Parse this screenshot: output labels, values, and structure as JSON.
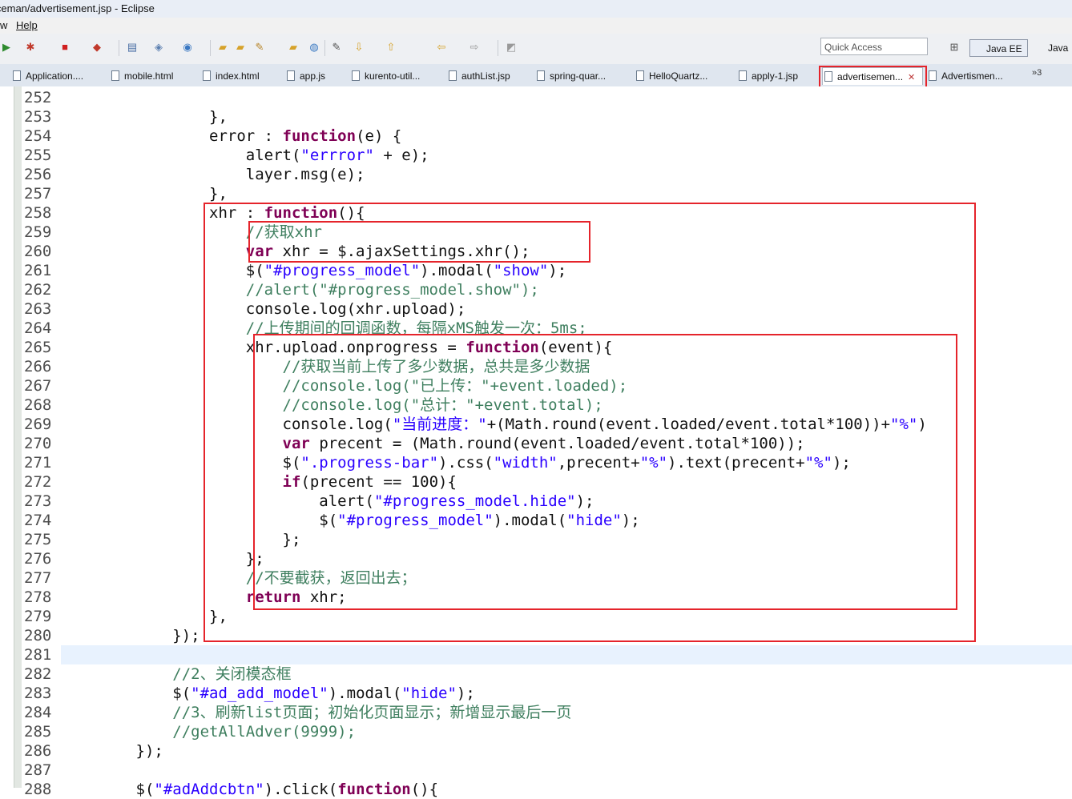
{
  "window": {
    "title": "iceman/advertisement.jsp - Eclipse"
  },
  "menu": {
    "items": [
      "w",
      "Help"
    ]
  },
  "toolbar": {
    "quick_access_placeholder": "Quick Access",
    "perspectives": [
      "Java EE",
      "Java"
    ]
  },
  "tabs": [
    {
      "label": "Application....",
      "active": false
    },
    {
      "label": "mobile.html",
      "active": false
    },
    {
      "label": "index.html",
      "active": false
    },
    {
      "label": "app.js",
      "active": false
    },
    {
      "label": "kurento-util...",
      "active": false
    },
    {
      "label": "authList.jsp",
      "active": false
    },
    {
      "label": "spring-quar...",
      "active": false
    },
    {
      "label": "HelloQuartz...",
      "active": false
    },
    {
      "label": "apply-1.jsp",
      "active": false
    },
    {
      "label": "advertisemen...",
      "active": true
    },
    {
      "label": "Advertismen...",
      "active": false
    }
  ],
  "tabs_overflow": "»3",
  "editor": {
    "highlight_color": "#e8f2fe",
    "annotation_color": "#e5242b",
    "lines": [
      {
        "n": "252",
        "code": []
      },
      {
        "n": "253",
        "code": [
          [
            "",
            "                },"
          ]
        ]
      },
      {
        "n": "254",
        "code": [
          [
            "",
            "                error : "
          ],
          [
            "kw",
            "function"
          ],
          [
            "",
            "(e) {"
          ]
        ]
      },
      {
        "n": "255",
        "code": [
          [
            "",
            "                    alert("
          ],
          [
            "str",
            "\"errror\""
          ],
          [
            "",
            " + e);"
          ]
        ]
      },
      {
        "n": "256",
        "code": [
          [
            "",
            "                    layer.msg(e);"
          ]
        ]
      },
      {
        "n": "257",
        "code": [
          [
            "",
            "                },"
          ]
        ]
      },
      {
        "n": "258",
        "code": [
          [
            "",
            "                xhr : "
          ],
          [
            "kw",
            "function"
          ],
          [
            "",
            "(){"
          ]
        ]
      },
      {
        "n": "259",
        "code": [
          [
            "",
            "                    "
          ],
          [
            "com",
            "//获取xhr"
          ]
        ]
      },
      {
        "n": "260",
        "code": [
          [
            "",
            "                    "
          ],
          [
            "kw",
            "var"
          ],
          [
            "",
            " xhr = $.ajaxSettings.xhr();"
          ]
        ]
      },
      {
        "n": "261",
        "code": [
          [
            "",
            "                    $("
          ],
          [
            "str",
            "\"#progress_model\""
          ],
          [
            "",
            ").modal("
          ],
          [
            "str",
            "\"show\""
          ],
          [
            "",
            ");"
          ]
        ]
      },
      {
        "n": "262",
        "code": [
          [
            "",
            "                    "
          ],
          [
            "com",
            "//alert(\"#progress_model.show\");"
          ]
        ]
      },
      {
        "n": "263",
        "code": [
          [
            "",
            "                    console.log(xhr.upload);"
          ]
        ]
      },
      {
        "n": "264",
        "code": [
          [
            "",
            "                    "
          ],
          [
            "com",
            "//上传期间的回调函数，每隔xMS触发一次：5ms;"
          ]
        ]
      },
      {
        "n": "265",
        "code": [
          [
            "",
            "                    xhr.upload.onprogress = "
          ],
          [
            "kw",
            "function"
          ],
          [
            "",
            "(event){"
          ]
        ]
      },
      {
        "n": "266",
        "code": [
          [
            "",
            "                        "
          ],
          [
            "com",
            "//获取当前上传了多少数据，总共是多少数据"
          ]
        ]
      },
      {
        "n": "267",
        "code": [
          [
            "",
            "                        "
          ],
          [
            "com",
            "//console.log(\"已上传：\"+event.loaded);"
          ]
        ]
      },
      {
        "n": "268",
        "code": [
          [
            "",
            "                        "
          ],
          [
            "com",
            "//console.log(\"总计：\"+event.total);"
          ]
        ]
      },
      {
        "n": "269",
        "code": [
          [
            "",
            "                        console.log("
          ],
          [
            "str",
            "\"当前进度：\""
          ],
          [
            "",
            "+(Math.round(event.loaded/event.total*100))+"
          ],
          [
            "str",
            "\"%\""
          ],
          [
            "",
            ")"
          ]
        ]
      },
      {
        "n": "270",
        "code": [
          [
            "",
            "                        "
          ],
          [
            "kw",
            "var"
          ],
          [
            "",
            " precent = (Math.round(event.loaded/event.total*100));"
          ]
        ]
      },
      {
        "n": "271",
        "code": [
          [
            "",
            "                        $("
          ],
          [
            "str",
            "\".progress-bar\""
          ],
          [
            "",
            ").css("
          ],
          [
            "str",
            "\"width\""
          ],
          [
            "",
            ",precent+"
          ],
          [
            "str",
            "\"%\""
          ],
          [
            "",
            ").text(precent+"
          ],
          [
            "str",
            "\"%\""
          ],
          [
            "",
            ");"
          ]
        ]
      },
      {
        "n": "272",
        "code": [
          [
            "",
            "                        "
          ],
          [
            "kw",
            "if"
          ],
          [
            "",
            "(precent == 100){"
          ]
        ]
      },
      {
        "n": "273",
        "code": [
          [
            "",
            "                            alert("
          ],
          [
            "str",
            "\"#progress_model.hide\""
          ],
          [
            "",
            ");"
          ]
        ]
      },
      {
        "n": "274",
        "code": [
          [
            "",
            "                            $("
          ],
          [
            "str",
            "\"#progress_model\""
          ],
          [
            "",
            ").modal("
          ],
          [
            "str",
            "\"hide\""
          ],
          [
            "",
            ");"
          ]
        ]
      },
      {
        "n": "275",
        "code": [
          [
            "",
            "                        };"
          ]
        ]
      },
      {
        "n": "276",
        "code": [
          [
            "",
            "                    };"
          ]
        ]
      },
      {
        "n": "277",
        "code": [
          [
            "",
            "                    "
          ],
          [
            "com",
            "//不要截获，返回出去；"
          ]
        ]
      },
      {
        "n": "278",
        "code": [
          [
            "",
            "                    "
          ],
          [
            "kw",
            "return"
          ],
          [
            "",
            " xhr;"
          ]
        ]
      },
      {
        "n": "279",
        "code": [
          [
            "",
            "                },"
          ]
        ]
      },
      {
        "n": "280",
        "code": [
          [
            "",
            "            });"
          ]
        ]
      },
      {
        "n": "281",
        "code": []
      },
      {
        "n": "282",
        "code": [
          [
            "",
            "            "
          ],
          [
            "com",
            "//2、关闭模态框"
          ]
        ]
      },
      {
        "n": "283",
        "code": [
          [
            "",
            "            $("
          ],
          [
            "str",
            "\"#ad_add_model\""
          ],
          [
            "",
            ").modal("
          ],
          [
            "str",
            "\"hide\""
          ],
          [
            "",
            ");"
          ]
        ]
      },
      {
        "n": "284",
        "code": [
          [
            "",
            "            "
          ],
          [
            "com",
            "//3、刷新list页面；初始化页面显示；新增显示最后一页"
          ]
        ]
      },
      {
        "n": "285",
        "code": [
          [
            "",
            "            "
          ],
          [
            "com",
            "//getAllAdver(9999);"
          ]
        ]
      },
      {
        "n": "286",
        "code": [
          [
            "",
            "        });"
          ]
        ]
      },
      {
        "n": "287",
        "code": []
      },
      {
        "n": "288",
        "code": [
          [
            "",
            "        $("
          ],
          [
            "str",
            "\"#adAddcbtn\""
          ],
          [
            "",
            ").click("
          ],
          [
            "kw",
            "function"
          ],
          [
            "",
            "(){"
          ]
        ]
      }
    ]
  }
}
